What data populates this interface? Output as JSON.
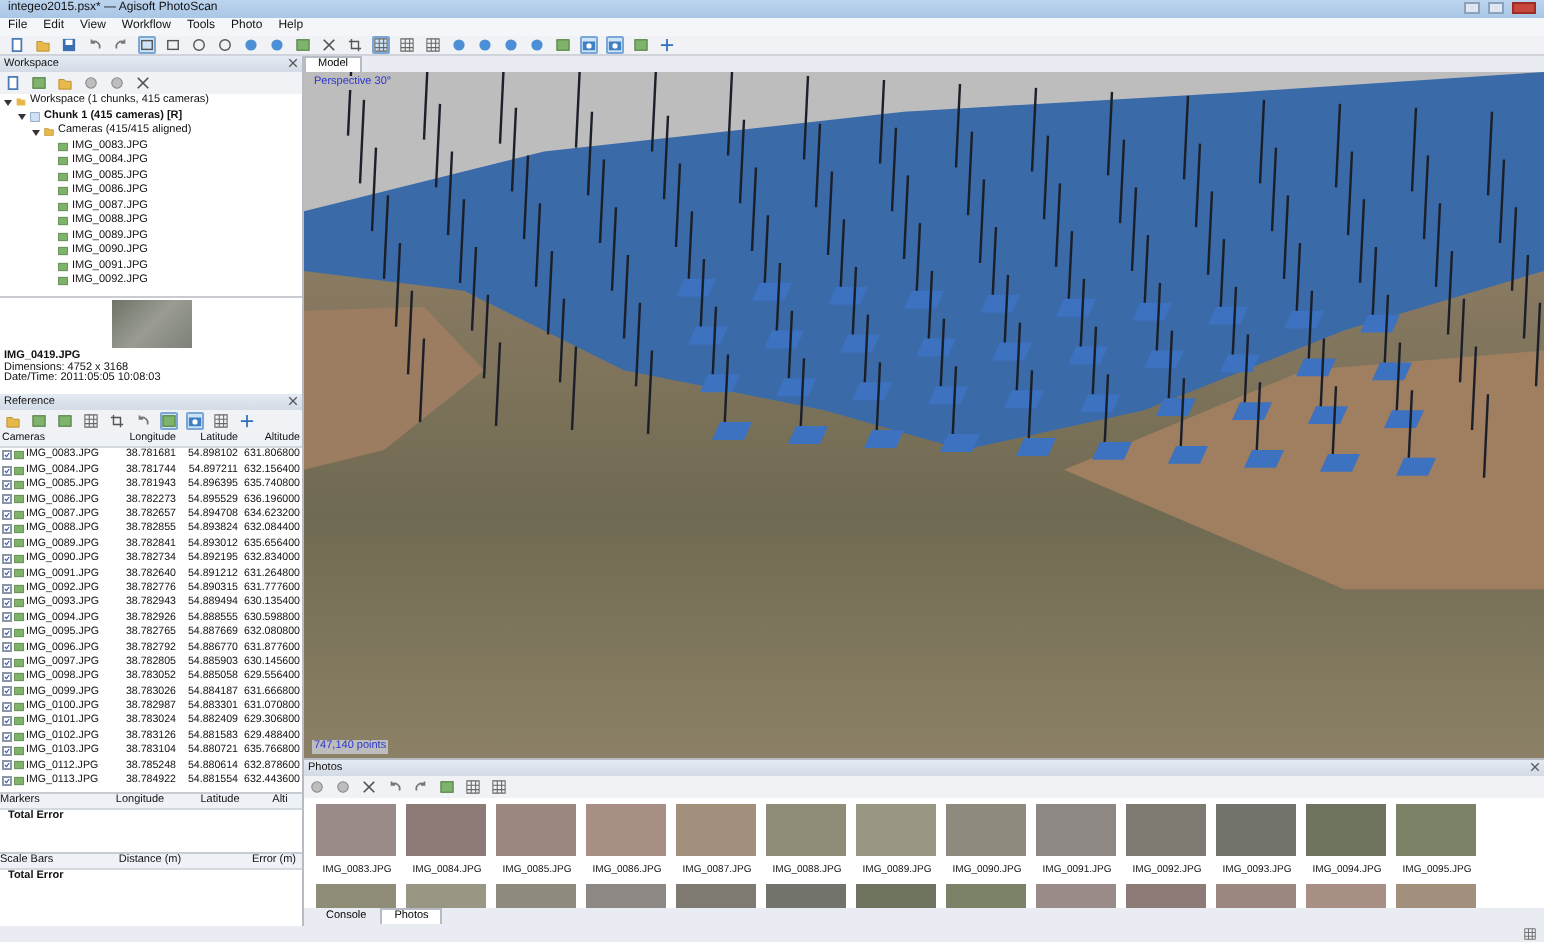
{
  "window": {
    "title": "integeo2015.psx* — Agisoft PhotoScan"
  },
  "menu": [
    "File",
    "Edit",
    "View",
    "Workflow",
    "Tools",
    "Photo",
    "Help"
  ],
  "main_toolbar": [
    {
      "kind": "document",
      "pressed": false
    },
    {
      "kind": "folder",
      "pressed": false
    },
    {
      "kind": "save",
      "pressed": false
    },
    {
      "kind": "undo",
      "pressed": false
    },
    {
      "kind": "redo",
      "pressed": false
    },
    {
      "kind": "rectangle",
      "pressed": true
    },
    {
      "kind": "rectangle",
      "pressed": false
    },
    {
      "kind": "circle",
      "pressed": false
    },
    {
      "kind": "circle",
      "pressed": false
    },
    {
      "kind": "sphere",
      "pressed": false
    },
    {
      "kind": "sphere",
      "pressed": false
    },
    {
      "kind": "image",
      "pressed": false
    },
    {
      "kind": "close",
      "pressed": false
    },
    {
      "kind": "crop",
      "pressed": false
    },
    {
      "kind": "grid",
      "pressed": true
    },
    {
      "kind": "grid",
      "pressed": false
    },
    {
      "kind": "grid",
      "pressed": false
    },
    {
      "kind": "sphere",
      "pressed": false
    },
    {
      "kind": "sphere",
      "pressed": false
    },
    {
      "kind": "sphere",
      "pressed": false
    },
    {
      "kind": "sphere",
      "pressed": false
    },
    {
      "kind": "image",
      "pressed": false
    },
    {
      "kind": "camera",
      "pressed": true
    },
    {
      "kind": "camera",
      "pressed": true
    },
    {
      "kind": "image",
      "pressed": false
    },
    {
      "kind": "move",
      "pressed": false
    }
  ],
  "workspace": {
    "title": "Workspace",
    "toolbar": [
      {
        "kind": "document"
      },
      {
        "kind": "image"
      },
      {
        "kind": "folder"
      },
      {
        "kind": "gear"
      },
      {
        "kind": "gear"
      },
      {
        "kind": "close"
      }
    ],
    "tree": [
      {
        "label": "Workspace (1 chunks, 415 cameras)",
        "kind": "workspace",
        "expanded": true,
        "children": [
          {
            "label": "Chunk 1 (415 cameras) [R]",
            "kind": "chunk",
            "expanded": true,
            "children": [
              {
                "label": "Cameras (415/415 aligned)",
                "kind": "folder",
                "expanded": true,
                "children": [
                  {
                    "label": "IMG_0083.JPG",
                    "kind": "camera"
                  },
                  {
                    "label": "IMG_0084.JPG",
                    "kind": "camera"
                  },
                  {
                    "label": "IMG_0085.JPG",
                    "kind": "camera"
                  },
                  {
                    "label": "IMG_0086.JPG",
                    "kind": "camera"
                  },
                  {
                    "label": "IMG_0087.JPG",
                    "kind": "camera"
                  },
                  {
                    "label": "IMG_0088.JPG",
                    "kind": "camera"
                  },
                  {
                    "label": "IMG_0089.JPG",
                    "kind": "camera"
                  },
                  {
                    "label": "IMG_0090.JPG",
                    "kind": "camera"
                  },
                  {
                    "label": "IMG_0091.JPG",
                    "kind": "camera"
                  },
                  {
                    "label": "IMG_0092.JPG",
                    "kind": "camera"
                  }
                ]
              }
            ]
          }
        ]
      }
    ],
    "preview": {
      "filename": "IMG_0419.JPG",
      "dimensions": "Dimensions: 4752 x 3168",
      "datetime": "Date/Time: 2011:05:05 10:08:03"
    }
  },
  "reference": {
    "title": "Reference",
    "toolbar": [
      {
        "kind": "folder",
        "pressed": false
      },
      {
        "kind": "image",
        "pressed": false
      },
      {
        "kind": "image",
        "pressed": false
      },
      {
        "kind": "grid",
        "pressed": false
      },
      {
        "kind": "crop",
        "pressed": false
      },
      {
        "kind": "undo",
        "pressed": false
      },
      {
        "kind": "image",
        "pressed": true
      },
      {
        "kind": "camera",
        "pressed": true
      },
      {
        "kind": "grid",
        "pressed": false
      },
      {
        "kind": "move",
        "pressed": false
      }
    ],
    "columns": [
      "Cameras",
      "Longitude",
      "Latitude",
      "Altitude"
    ],
    "rows": [
      {
        "name": "IMG_0083.JPG",
        "checked": true,
        "longitude": "38.781681",
        "latitude": "54.898102",
        "altitude": "631.806800"
      },
      {
        "name": "IMG_0084.JPG",
        "checked": true,
        "longitude": "38.781744",
        "latitude": "54.897211",
        "altitude": "632.156400"
      },
      {
        "name": "IMG_0085.JPG",
        "checked": true,
        "longitude": "38.781943",
        "latitude": "54.896395",
        "altitude": "635.740800"
      },
      {
        "name": "IMG_0086.JPG",
        "checked": true,
        "longitude": "38.782273",
        "latitude": "54.895529",
        "altitude": "636.196000"
      },
      {
        "name": "IMG_0087.JPG",
        "checked": true,
        "longitude": "38.782657",
        "latitude": "54.894708",
        "altitude": "634.623200"
      },
      {
        "name": "IMG_0088.JPG",
        "checked": true,
        "longitude": "38.782855",
        "latitude": "54.893824",
        "altitude": "632.084400"
      },
      {
        "name": "IMG_0089.JPG",
        "checked": true,
        "longitude": "38.782841",
        "latitude": "54.893012",
        "altitude": "635.656400"
      },
      {
        "name": "IMG_0090.JPG",
        "checked": true,
        "longitude": "38.782734",
        "latitude": "54.892195",
        "altitude": "632.834000"
      },
      {
        "name": "IMG_0091.JPG",
        "checked": true,
        "longitude": "38.782640",
        "latitude": "54.891212",
        "altitude": "631.264800"
      },
      {
        "name": "IMG_0092.JPG",
        "checked": true,
        "longitude": "38.782776",
        "latitude": "54.890315",
        "altitude": "631.777600"
      },
      {
        "name": "IMG_0093.JPG",
        "checked": true,
        "longitude": "38.782943",
        "latitude": "54.889494",
        "altitude": "630.135400"
      },
      {
        "name": "IMG_0094.JPG",
        "checked": true,
        "longitude": "38.782926",
        "latitude": "54.888555",
        "altitude": "630.598800"
      },
      {
        "name": "IMG_0095.JPG",
        "checked": true,
        "longitude": "38.782765",
        "latitude": "54.887669",
        "altitude": "632.080800"
      },
      {
        "name": "IMG_0096.JPG",
        "checked": true,
        "longitude": "38.782792",
        "latitude": "54.886770",
        "altitude": "631.877600"
      },
      {
        "name": "IMG_0097.JPG",
        "checked": true,
        "longitude": "38.782805",
        "latitude": "54.885903",
        "altitude": "630.145600"
      },
      {
        "name": "IMG_0098.JPG",
        "checked": true,
        "longitude": "38.783052",
        "latitude": "54.885058",
        "altitude": "629.556400"
      },
      {
        "name": "IMG_0099.JPG",
        "checked": true,
        "longitude": "38.783026",
        "latitude": "54.884187",
        "altitude": "631.666800"
      },
      {
        "name": "IMG_0100.JPG",
        "checked": true,
        "longitude": "38.782987",
        "latitude": "54.883301",
        "altitude": "631.070800"
      },
      {
        "name": "IMG_0101.JPG",
        "checked": true,
        "longitude": "38.783024",
        "latitude": "54.882409",
        "altitude": "629.306800"
      },
      {
        "name": "IMG_0102.JPG",
        "checked": true,
        "longitude": "38.783126",
        "latitude": "54.881583",
        "altitude": "629.488400"
      },
      {
        "name": "IMG_0103.JPG",
        "checked": true,
        "longitude": "38.783104",
        "latitude": "54.880721",
        "altitude": "635.766800"
      },
      {
        "name": "IMG_0112.JPG",
        "checked": true,
        "longitude": "38.785248",
        "latitude": "54.880614",
        "altitude": "632.878600"
      },
      {
        "name": "IMG_0113.JPG",
        "checked": true,
        "longitude": "38.784922",
        "latitude": "54.881554",
        "altitude": "632.443600"
      }
    ],
    "markers": {
      "columns": [
        "Markers",
        "Longitude",
        "Latitude",
        "Alti"
      ],
      "total": "Total Error"
    },
    "scale_bars": {
      "columns": [
        "Scale Bars",
        "Distance (m)",
        "Error (m)"
      ],
      "total": "Total Error"
    }
  },
  "model": {
    "tabs": [
      {
        "label": "Model",
        "selected": true
      }
    ],
    "view_label": "Perspective 30°",
    "points": "747,140 points"
  },
  "photos": {
    "title": "Photos",
    "toolbar": [
      {
        "kind": "gear"
      },
      {
        "kind": "gear"
      },
      {
        "kind": "close"
      },
      {
        "kind": "undo"
      },
      {
        "kind": "redo"
      },
      {
        "kind": "image"
      },
      {
        "kind": "grid"
      },
      {
        "kind": "grid"
      }
    ],
    "thumbnails": [
      {
        "label": "IMG_0083.JPG"
      },
      {
        "label": "IMG_0084.JPG"
      },
      {
        "label": "IMG_0085.JPG"
      },
      {
        "label": "IMG_0086.JPG"
      },
      {
        "label": "IMG_0087.JPG"
      },
      {
        "label": "IMG_0088.JPG"
      },
      {
        "label": "IMG_0089.JPG"
      },
      {
        "label": "IMG_0090.JPG"
      },
      {
        "label": "IMG_0091.JPG"
      },
      {
        "label": "IMG_0092.JPG"
      },
      {
        "label": "IMG_0093.JPG"
      },
      {
        "label": "IMG_0094.JPG"
      },
      {
        "label": "IMG_0095.JPG"
      }
    ],
    "tabs": [
      {
        "label": "Console",
        "selected": false
      },
      {
        "label": "Photos",
        "selected": true
      }
    ]
  }
}
